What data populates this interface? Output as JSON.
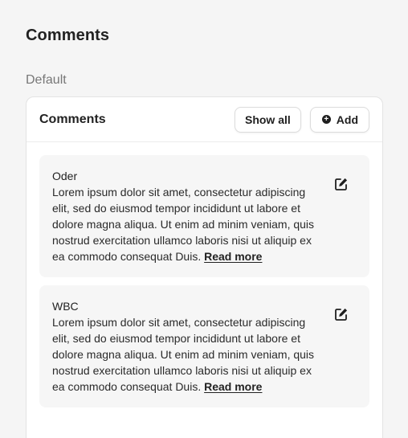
{
  "page": {
    "title": "Comments",
    "section_label": "Default"
  },
  "panel": {
    "title": "Comments",
    "show_all_label": "Show all",
    "add_label": "Add"
  },
  "icons": {
    "add": "plus-circle-icon",
    "edit": "edit-icon"
  },
  "comments": [
    {
      "author": "Oder",
      "text": "Lorem ipsum dolor sit amet, consectetur adipiscing elit, sed do eiusmod tempor incididunt ut labore et dolore magna aliqua. Ut enim ad minim veniam, quis nostrud exercitation ullamco laboris nisi ut aliquip ex ea commodo consequat Duis.",
      "read_more": "Read more"
    },
    {
      "author": "WBC",
      "text": "Lorem ipsum dolor sit amet, consectetur adipiscing elit, sed do eiusmod tempor incididunt ut labore et dolore magna aliqua. Ut enim ad minim veniam, quis nostrud exercitation ullamco laboris nisi ut aliquip ex ea commodo consequat Duis.",
      "read_more": "Read more"
    }
  ]
}
